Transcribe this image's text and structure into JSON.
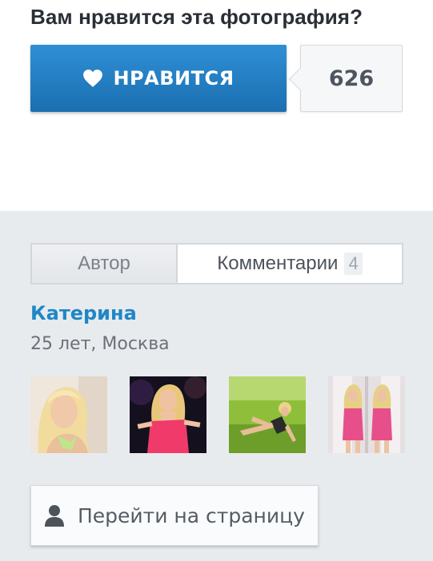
{
  "like_section": {
    "question": "Вам нравится эта фотография?",
    "like_label": "НРАВИТСЯ",
    "like_count": "626",
    "heart_icon": "heart-icon"
  },
  "profile_panel": {
    "tabs": [
      {
        "label": "Автор",
        "active": true
      },
      {
        "label": "Комментарии",
        "badge": "4",
        "active": false
      }
    ],
    "name": "Катерина",
    "meta": "25 лет, Москва",
    "photos": [
      {
        "desc": "blonde-portrait-thumbnail"
      },
      {
        "desc": "woman-pink-dress-night-thumbnail"
      },
      {
        "desc": "woman-on-grass-thumbnail"
      },
      {
        "desc": "woman-mirror-doors-thumbnail"
      }
    ],
    "profile_button_label": "Перейти на страницу",
    "user_icon": "user-icon"
  },
  "colors": {
    "accent_blue": "#1f87c6",
    "button_blue": "#2a86cf",
    "panel_bg": "#e8ebee"
  }
}
